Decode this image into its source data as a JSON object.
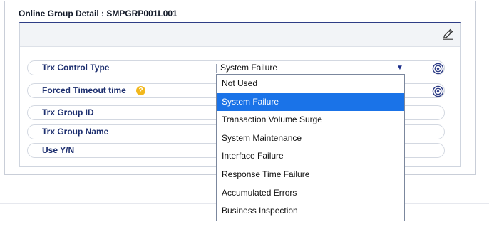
{
  "page": {
    "title": "Online Group Detail : SMPGRP001L001"
  },
  "form": {
    "rows": [
      {
        "label": "Trx Control Type"
      },
      {
        "label": "Forced Timeout time"
      },
      {
        "label": "Trx Group ID"
      },
      {
        "label": "Trx Group Name"
      },
      {
        "label": "Use Y/N"
      }
    ],
    "trx_control_type_value": "System Failure"
  },
  "dropdown": {
    "options": [
      "Not Used",
      "System Failure",
      "Transaction Volume Surge",
      "System Maintenance",
      "Interface Failure",
      "Response Time Failure",
      "Accumulated Errors",
      "Business Inspection"
    ],
    "selected_index": 1
  },
  "icons": {
    "edit": "pencil-icon",
    "help": "question-icon",
    "target": "target-icon",
    "caret": "caret-down-icon"
  },
  "colors": {
    "accent": "#2e3d86",
    "selected": "#1a73e8",
    "help": "#f2b81d"
  }
}
